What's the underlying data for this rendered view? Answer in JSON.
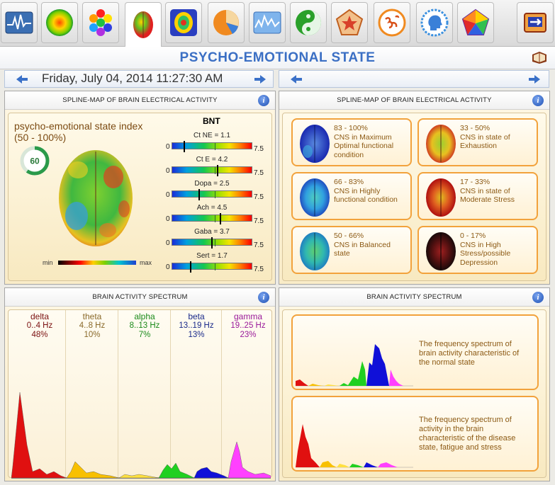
{
  "title": "PSYCHO-EMOTIONAL STATE",
  "date_left": "Friday, July 04, 2014 11:27:30 AM",
  "toolbar_icons": [
    "ecg-wave-icon",
    "aura-sphere-icon",
    "color-hexagons-icon",
    "brain-map-icon",
    "body-scan-icon",
    "pie-chart-icon",
    "spectrum-wave-icon",
    "yin-yang-icon",
    "pentagon-star-icon",
    "om-symbol-icon",
    "head-silhouette-icon",
    "color-pentagon-icon",
    "exit-icon"
  ],
  "panel1": {
    "header": "SPLINE-MAP OF BRAIN ELECTRICAL ACTIVITY",
    "index_label": "psycho-emotional state index",
    "index_range": "(50 - 100%)",
    "gauge_value": "60",
    "gauge_fraction": 0.6,
    "min_label": "min",
    "max_label": "max",
    "bnt_title": "BNT",
    "scale_min": "0",
    "scale_max": "7.5",
    "bars": [
      {
        "label": "Ct NE = 1.1",
        "value": 1.1
      },
      {
        "label": "Ct E = 4.2",
        "value": 4.2
      },
      {
        "label": "Dopa = 2.5",
        "value": 2.5
      },
      {
        "label": "Ach = 4.5",
        "value": 4.5
      },
      {
        "label": "Gaba = 3.7",
        "value": 3.7
      },
      {
        "label": "Sert = 1.7",
        "value": 1.7
      }
    ]
  },
  "panel2": {
    "header": "SPLINE-MAP OF BRAIN ELECTRICAL ACTIVITY",
    "cards": [
      {
        "line1": "83 - 100%",
        "line2": "CNS in Maximum",
        "line3": "Optimal functional",
        "line4": "condition"
      },
      {
        "line1": "33 - 50%",
        "line2": "CNS in state of",
        "line3": "Exhaustion",
        "line4": ""
      },
      {
        "line1": "66 - 83%",
        "line2": "CNS in Highly",
        "line3": "functional condition",
        "line4": ""
      },
      {
        "line1": "17 - 33%",
        "line2": "CNS in state of",
        "line3": "Moderate Stress",
        "line4": ""
      },
      {
        "line1": "50 - 66%",
        "line2": "CNS in Balanced",
        "line3": "state",
        "line4": ""
      },
      {
        "line1": "0 - 17%",
        "line2": "CNS in High",
        "line3": "Stress/possible",
        "line4": "Depression"
      }
    ]
  },
  "panel3": {
    "header": "BRAIN ACTIVITY SPECTRUM",
    "bands": [
      {
        "name": "delta",
        "range": "0..4 Hz",
        "pct": "48%",
        "color": "#7a1010"
      },
      {
        "name": "theta",
        "range": "4..8 Hz",
        "pct": "10%",
        "color": "#8a6a2a"
      },
      {
        "name": "alpha",
        "range": "8..13 Hz",
        "pct": "7%",
        "color": "#1a8a1a"
      },
      {
        "name": "beta",
        "range": "13..19 Hz",
        "pct": "13%",
        "color": "#1a2a8a"
      },
      {
        "name": "gamma",
        "range": "19..25 Hz",
        "pct": "23%",
        "color": "#9a1a9a"
      }
    ]
  },
  "panel4": {
    "header": "BRAIN ACTIVITY SPECTRUM",
    "normal": {
      "line1": "The frequency spectrum of",
      "line2": "brain activity characteristic of",
      "line3": "the normal state",
      "line4": ""
    },
    "disease": {
      "line1": "The frequency spectrum of",
      "line2": "activity in the brain",
      "line3": "characteristic of the disease",
      "line4": "state, fatigue and stress"
    }
  }
}
